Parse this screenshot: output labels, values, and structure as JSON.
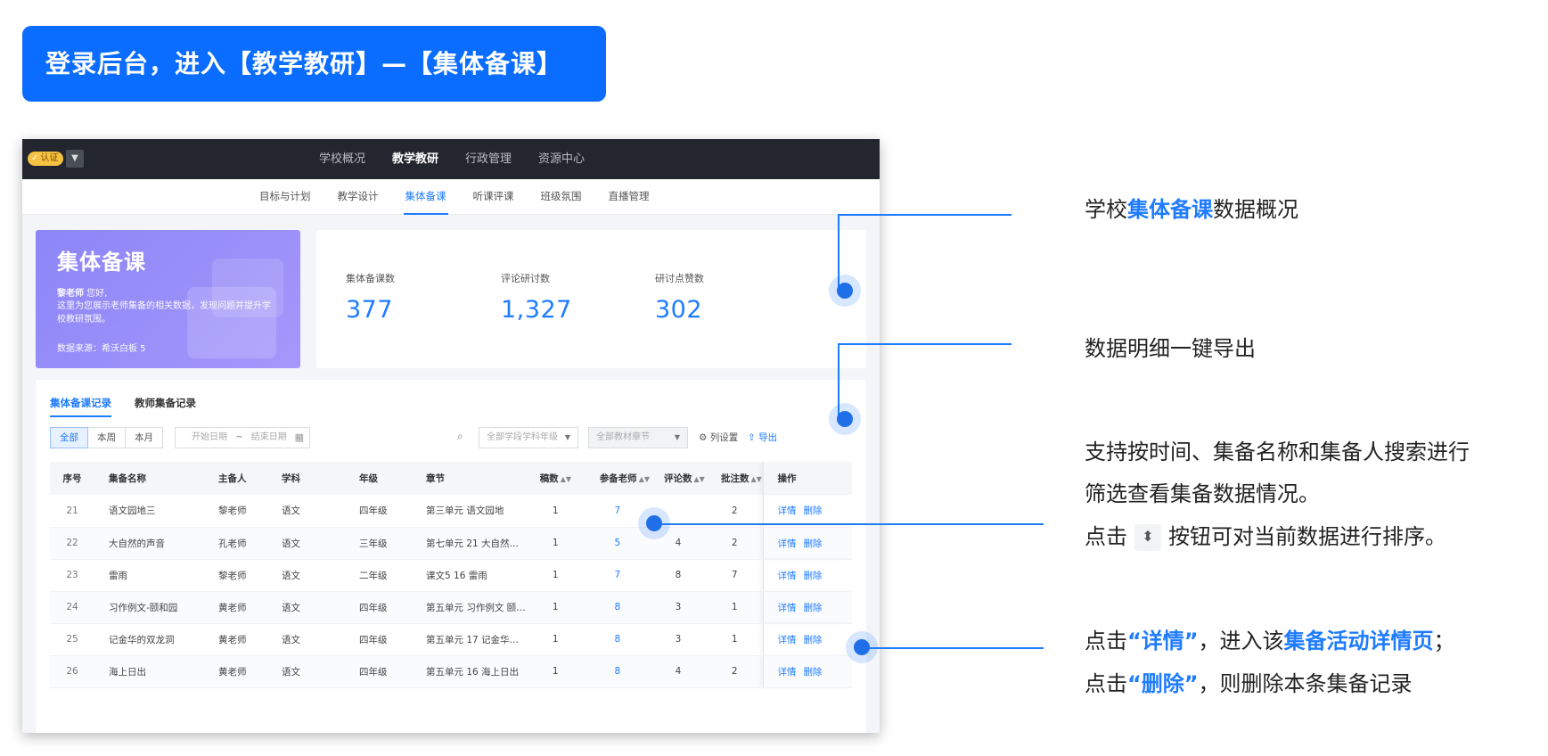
{
  "banner": {
    "text": "登录后台，进入【教学教研】—【集体备课】"
  },
  "topbar": {
    "badge": "认证",
    "nav": [
      "学校概况",
      "教学教研",
      "行政管理",
      "资源中心"
    ],
    "active": 1
  },
  "subnav": {
    "items": [
      "目标与计划",
      "教学设计",
      "集体备课",
      "听课评课",
      "班级氛围",
      "直播管理"
    ],
    "active": 2
  },
  "hero": {
    "title": "集体备课",
    "greet_name": "黎老师",
    "greet_suffix": " 您好,",
    "desc": "这里为您展示老师集备的相关数据，发现问题并提升学校教研氛围。",
    "source": "数据来源：希沃白板 5"
  },
  "stats": [
    {
      "label": "集体备课数",
      "value": "377"
    },
    {
      "label": "评论研讨数",
      "value": "1,327"
    },
    {
      "label": "研讨点赞数",
      "value": "302"
    }
  ],
  "tabs": [
    "集体备课记录",
    "教师集备记录"
  ],
  "filters": {
    "segments": [
      "全部",
      "本周",
      "本月"
    ],
    "start_placeholder": "开始日期",
    "sep": "~",
    "end_placeholder": "结束日期",
    "grade_select": "全部学段学科年级",
    "chapter_select": "全部教材章节",
    "columns_btn": "列设置",
    "export_btn": "导出"
  },
  "table": {
    "headers": [
      "序号",
      "集备名称",
      "主备人",
      "学科",
      "年级",
      "章节",
      "稿数",
      "参备老师",
      "评论数",
      "批注数",
      "操作"
    ],
    "rows": [
      [
        "21",
        "语文园地三",
        "黎老师",
        "语文",
        "四年级",
        "第三单元 语文园地",
        "1",
        "7",
        "",
        "2"
      ],
      [
        "22",
        "大自然的声音",
        "孔老师",
        "语文",
        "三年级",
        "第七单元 21 大自然…",
        "1",
        "5",
        "4",
        "2"
      ],
      [
        "23",
        "雷雨",
        "黎老师",
        "语文",
        "二年级",
        "课文5 16 雷雨",
        "1",
        "7",
        "8",
        "7"
      ],
      [
        "24",
        "习作例文-颐和园",
        "黄老师",
        "语文",
        "四年级",
        "第五单元 习作例文 颐…",
        "1",
        "8",
        "3",
        "1"
      ],
      [
        "25",
        "记金华的双龙洞",
        "黄老师",
        "语文",
        "四年级",
        "第五单元 17 记金华…",
        "1",
        "8",
        "3",
        "1"
      ],
      [
        "26",
        "海上日出",
        "黄老师",
        "语文",
        "四年级",
        "第五单元 16 海上日出",
        "1",
        "8",
        "4",
        "2"
      ]
    ],
    "op_detail": "详情",
    "op_delete": "删除"
  },
  "notes": {
    "n1_pre": "学校",
    "n1_hl": "集体备课",
    "n1_post": "数据概况",
    "n2": "数据明细一键导出",
    "n3_line1": "支持按时间、集备名称和集备人搜索进行",
    "n3_line2": "筛选查看集备数据情况。",
    "n3_line3_pre": "点击",
    "n3_line3_post": "按钮可对当前数据进行排序。",
    "n4_line1_pre": "点击",
    "n4_line1_q1": "“详情”",
    "n4_line1_mid": "，进入该",
    "n4_line1_hl": "集备活动详情页",
    "n4_line1_end": "；",
    "n4_line2_pre": "点击",
    "n4_line2_q": "“删除”",
    "n4_line2_post": "，则删除本条集备记录"
  },
  "colors": {
    "accent": "#1f7cff",
    "banner": "#0a6dff",
    "topbar": "#23262e",
    "hero": "#8c86f7"
  }
}
